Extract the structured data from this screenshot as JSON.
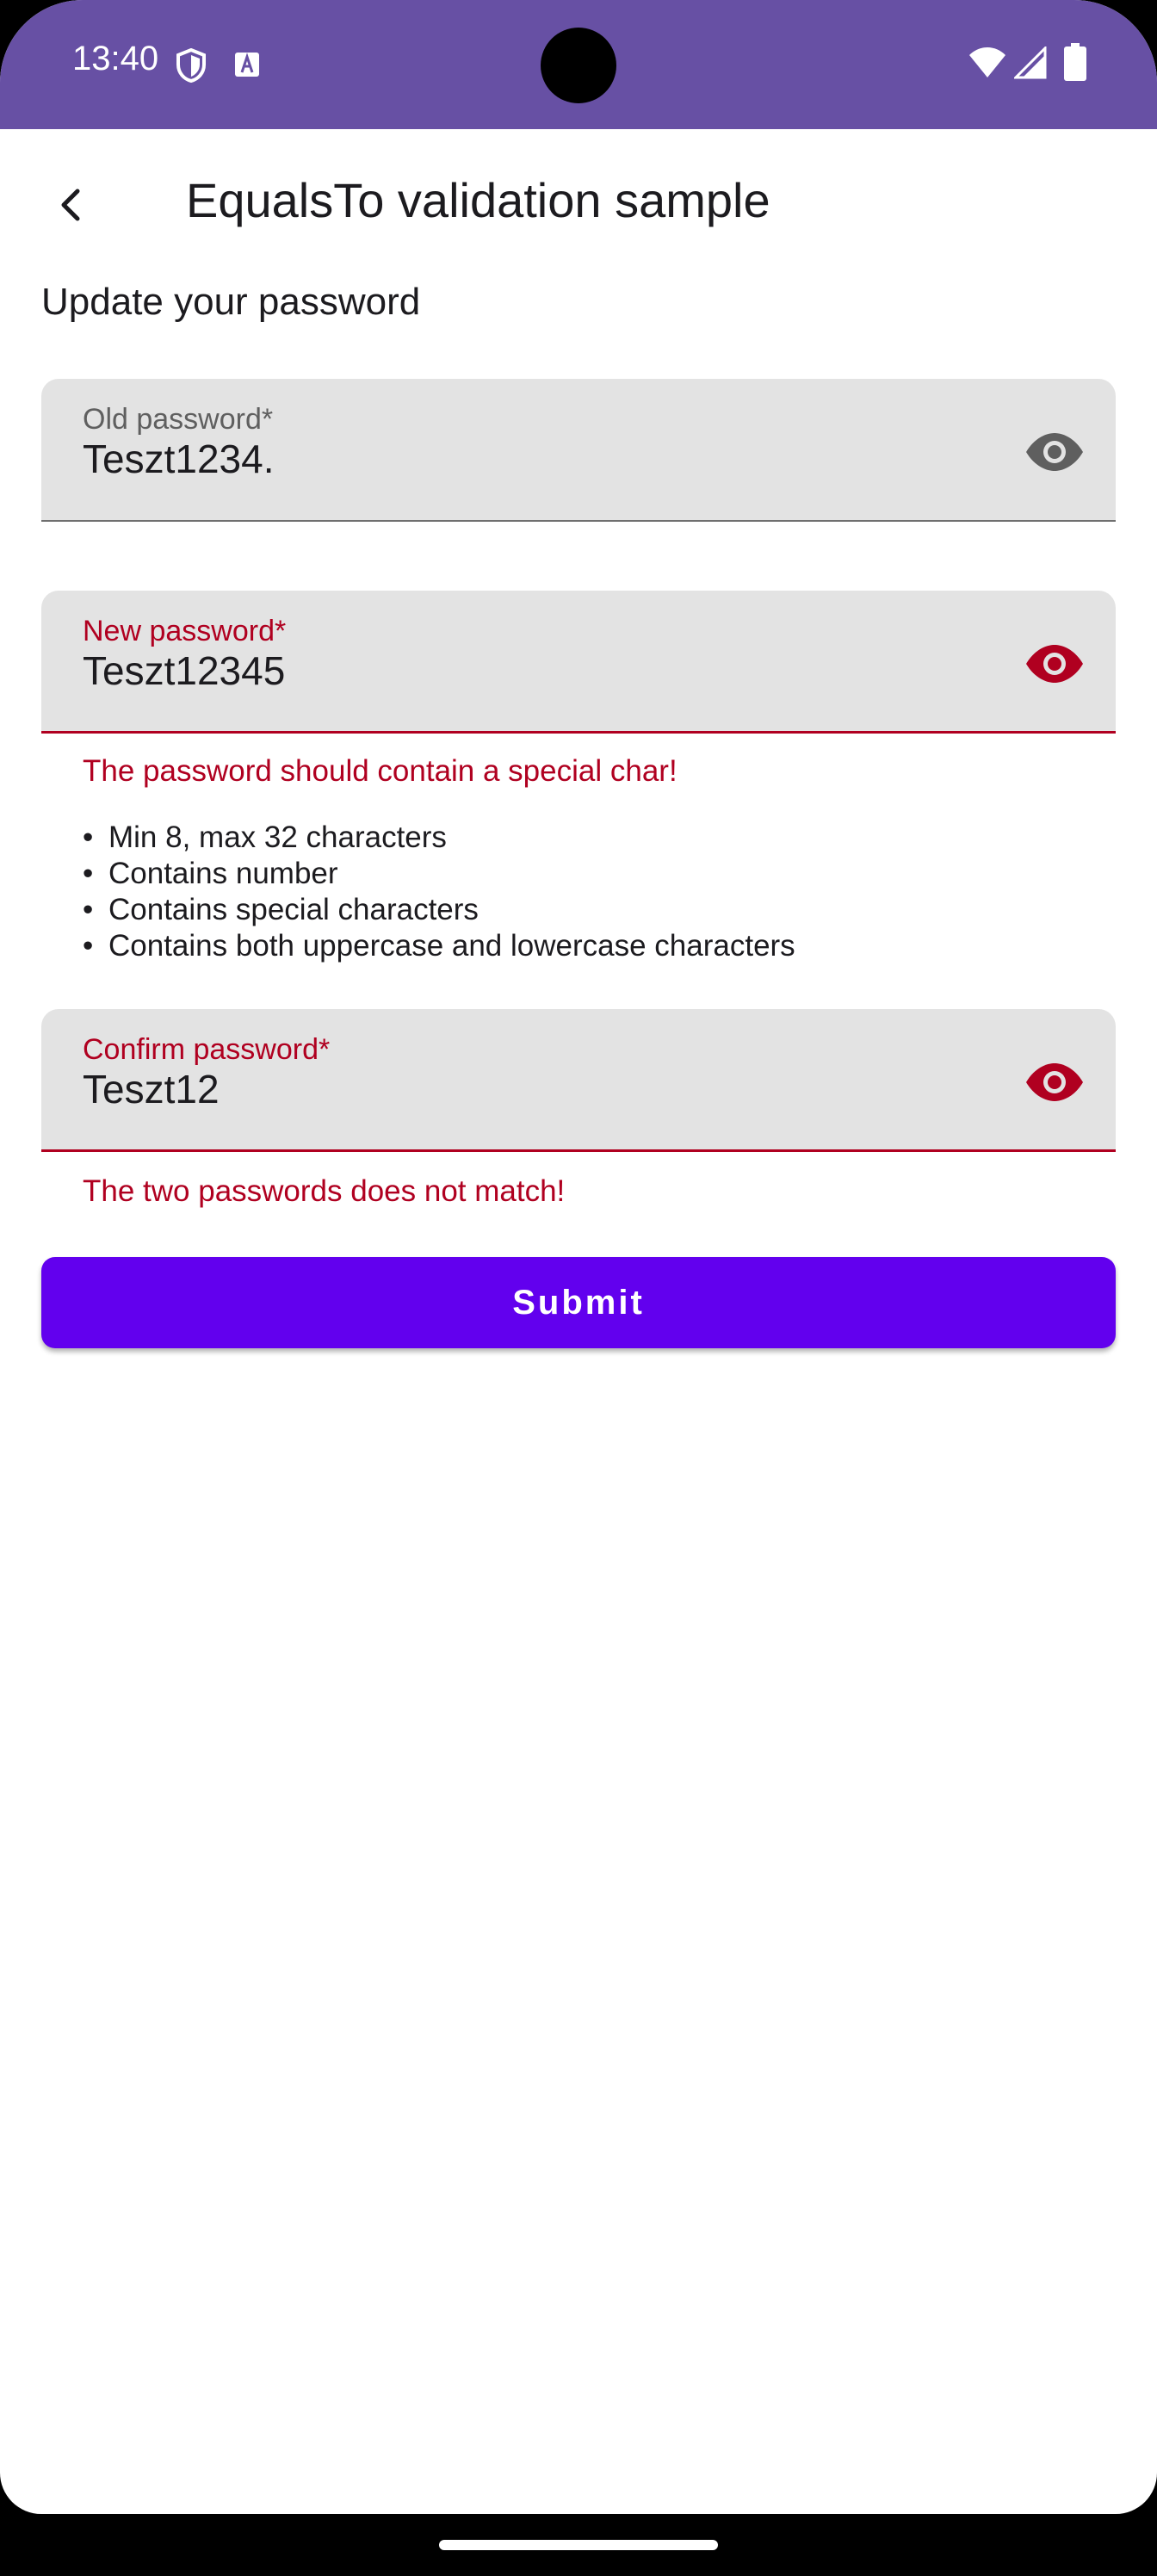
{
  "status_bar": {
    "time": "13:40",
    "icons": [
      "shield-icon",
      "text-a-icon",
      "wifi-icon",
      "signal-icon",
      "battery-icon"
    ],
    "color": "#6750a4"
  },
  "app_bar": {
    "title": "EqualsTo validation sample",
    "back_icon": "chevron-left-icon"
  },
  "form": {
    "section_title": "Update your password",
    "old_password": {
      "label": "Old password*",
      "value": "Teszt1234."
    },
    "new_password": {
      "label": "New password*",
      "value": "Teszt12345",
      "error": "The password should contain a special char!"
    },
    "rules": [
      "Min 8, max 32 characters",
      "Contains number",
      "Contains special characters",
      "Contains both uppercase and lowercase characters"
    ],
    "confirm_password": {
      "label": "Confirm password*",
      "value": "Teszt12",
      "error": "The two passwords does not match!"
    },
    "submit_label": "Submit"
  },
  "colors": {
    "error": "#b00020",
    "button": "#6200ee",
    "field_bg": "#e3e3e3"
  }
}
